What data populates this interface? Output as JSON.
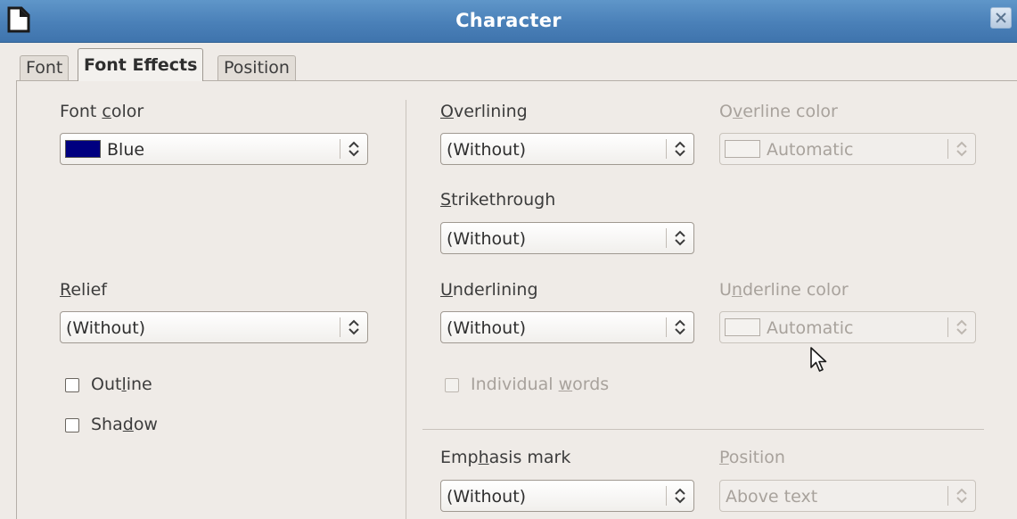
{
  "window": {
    "title": "Character",
    "app_icon": "document-icon",
    "close_icon": "close-icon"
  },
  "tabs": [
    {
      "label": "Font",
      "active": false
    },
    {
      "label": "Font Effects",
      "active": true
    },
    {
      "label": "Position",
      "active": false
    }
  ],
  "font_color": {
    "label_pre": "Font ",
    "label_mnemonic": "c",
    "label_post": "olor",
    "value": "Blue",
    "swatch_color": "#000080"
  },
  "relief": {
    "label_pre": "",
    "label_mnemonic": "R",
    "label_post": "elief",
    "value": "(Without)"
  },
  "outline": {
    "label_pre": "Out",
    "label_mnemonic": "l",
    "label_post": "ine",
    "checked": false
  },
  "shadow": {
    "label_pre": "Sha",
    "label_mnemonic": "d",
    "label_post": "ow",
    "checked": false
  },
  "overlining": {
    "label_pre": "",
    "label_mnemonic": "O",
    "label_post": "verlining",
    "value": "(Without)"
  },
  "overline_color": {
    "label_pre": "O",
    "label_mnemonic": "v",
    "label_post": "erline color",
    "value": "Automatic",
    "disabled": true
  },
  "strikethrough": {
    "label_pre": "",
    "label_mnemonic": "S",
    "label_post": "trikethrough",
    "value": "(Without)"
  },
  "underlining": {
    "label_pre": "",
    "label_mnemonic": "U",
    "label_post": "nderlining",
    "value": "(Without)"
  },
  "underline_color": {
    "label_pre": "U",
    "label_mnemonic": "n",
    "label_post": "derline color",
    "value": "Automatic",
    "disabled": true
  },
  "individual_words": {
    "label_pre": "Individual ",
    "label_mnemonic": "w",
    "label_post": "ords",
    "checked": false,
    "disabled": true
  },
  "emphasis_mark": {
    "label_pre": "Emp",
    "label_mnemonic": "h",
    "label_post": "asis mark",
    "value": "(Without)"
  },
  "emphasis_position": {
    "label_pre": "",
    "label_mnemonic": "P",
    "label_post": "osition",
    "value": "Above text",
    "disabled": true
  },
  "colors": {
    "titlebar": "#4a80b8",
    "background": "#efebe7",
    "disabled_text": "#a8a29c"
  }
}
